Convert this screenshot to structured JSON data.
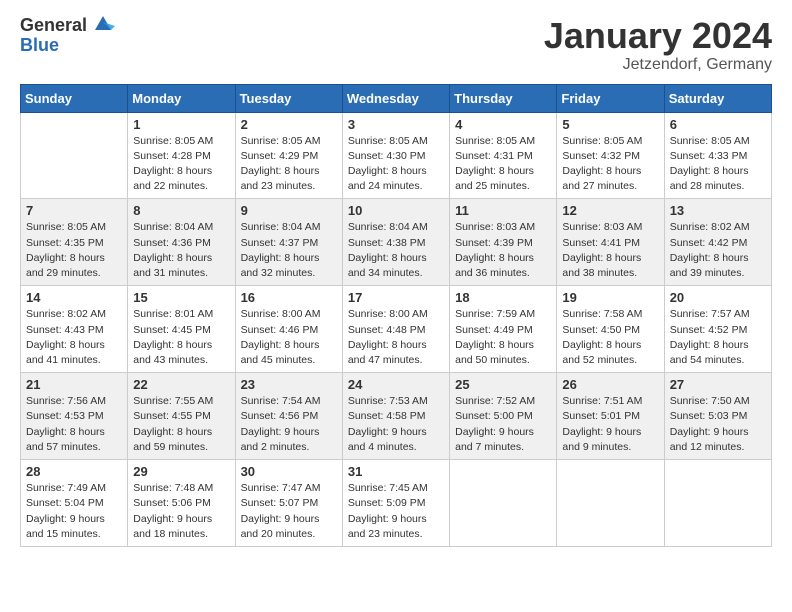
{
  "header": {
    "logo_general": "General",
    "logo_blue": "Blue",
    "month_title": "January 2024",
    "location": "Jetzendorf, Germany"
  },
  "days_of_week": [
    "Sunday",
    "Monday",
    "Tuesday",
    "Wednesday",
    "Thursday",
    "Friday",
    "Saturday"
  ],
  "weeks": [
    [
      {
        "day": "",
        "sunrise": "",
        "sunset": "",
        "daylight": ""
      },
      {
        "day": "1",
        "sunrise": "Sunrise: 8:05 AM",
        "sunset": "Sunset: 4:28 PM",
        "daylight": "Daylight: 8 hours and 22 minutes."
      },
      {
        "day": "2",
        "sunrise": "Sunrise: 8:05 AM",
        "sunset": "Sunset: 4:29 PM",
        "daylight": "Daylight: 8 hours and 23 minutes."
      },
      {
        "day": "3",
        "sunrise": "Sunrise: 8:05 AM",
        "sunset": "Sunset: 4:30 PM",
        "daylight": "Daylight: 8 hours and 24 minutes."
      },
      {
        "day": "4",
        "sunrise": "Sunrise: 8:05 AM",
        "sunset": "Sunset: 4:31 PM",
        "daylight": "Daylight: 8 hours and 25 minutes."
      },
      {
        "day": "5",
        "sunrise": "Sunrise: 8:05 AM",
        "sunset": "Sunset: 4:32 PM",
        "daylight": "Daylight: 8 hours and 27 minutes."
      },
      {
        "day": "6",
        "sunrise": "Sunrise: 8:05 AM",
        "sunset": "Sunset: 4:33 PM",
        "daylight": "Daylight: 8 hours and 28 minutes."
      }
    ],
    [
      {
        "day": "7",
        "sunrise": "Sunrise: 8:05 AM",
        "sunset": "Sunset: 4:35 PM",
        "daylight": "Daylight: 8 hours and 29 minutes."
      },
      {
        "day": "8",
        "sunrise": "Sunrise: 8:04 AM",
        "sunset": "Sunset: 4:36 PM",
        "daylight": "Daylight: 8 hours and 31 minutes."
      },
      {
        "day": "9",
        "sunrise": "Sunrise: 8:04 AM",
        "sunset": "Sunset: 4:37 PM",
        "daylight": "Daylight: 8 hours and 32 minutes."
      },
      {
        "day": "10",
        "sunrise": "Sunrise: 8:04 AM",
        "sunset": "Sunset: 4:38 PM",
        "daylight": "Daylight: 8 hours and 34 minutes."
      },
      {
        "day": "11",
        "sunrise": "Sunrise: 8:03 AM",
        "sunset": "Sunset: 4:39 PM",
        "daylight": "Daylight: 8 hours and 36 minutes."
      },
      {
        "day": "12",
        "sunrise": "Sunrise: 8:03 AM",
        "sunset": "Sunset: 4:41 PM",
        "daylight": "Daylight: 8 hours and 38 minutes."
      },
      {
        "day": "13",
        "sunrise": "Sunrise: 8:02 AM",
        "sunset": "Sunset: 4:42 PM",
        "daylight": "Daylight: 8 hours and 39 minutes."
      }
    ],
    [
      {
        "day": "14",
        "sunrise": "Sunrise: 8:02 AM",
        "sunset": "Sunset: 4:43 PM",
        "daylight": "Daylight: 8 hours and 41 minutes."
      },
      {
        "day": "15",
        "sunrise": "Sunrise: 8:01 AM",
        "sunset": "Sunset: 4:45 PM",
        "daylight": "Daylight: 8 hours and 43 minutes."
      },
      {
        "day": "16",
        "sunrise": "Sunrise: 8:00 AM",
        "sunset": "Sunset: 4:46 PM",
        "daylight": "Daylight: 8 hours and 45 minutes."
      },
      {
        "day": "17",
        "sunrise": "Sunrise: 8:00 AM",
        "sunset": "Sunset: 4:48 PM",
        "daylight": "Daylight: 8 hours and 47 minutes."
      },
      {
        "day": "18",
        "sunrise": "Sunrise: 7:59 AM",
        "sunset": "Sunset: 4:49 PM",
        "daylight": "Daylight: 8 hours and 50 minutes."
      },
      {
        "day": "19",
        "sunrise": "Sunrise: 7:58 AM",
        "sunset": "Sunset: 4:50 PM",
        "daylight": "Daylight: 8 hours and 52 minutes."
      },
      {
        "day": "20",
        "sunrise": "Sunrise: 7:57 AM",
        "sunset": "Sunset: 4:52 PM",
        "daylight": "Daylight: 8 hours and 54 minutes."
      }
    ],
    [
      {
        "day": "21",
        "sunrise": "Sunrise: 7:56 AM",
        "sunset": "Sunset: 4:53 PM",
        "daylight": "Daylight: 8 hours and 57 minutes."
      },
      {
        "day": "22",
        "sunrise": "Sunrise: 7:55 AM",
        "sunset": "Sunset: 4:55 PM",
        "daylight": "Daylight: 8 hours and 59 minutes."
      },
      {
        "day": "23",
        "sunrise": "Sunrise: 7:54 AM",
        "sunset": "Sunset: 4:56 PM",
        "daylight": "Daylight: 9 hours and 2 minutes."
      },
      {
        "day": "24",
        "sunrise": "Sunrise: 7:53 AM",
        "sunset": "Sunset: 4:58 PM",
        "daylight": "Daylight: 9 hours and 4 minutes."
      },
      {
        "day": "25",
        "sunrise": "Sunrise: 7:52 AM",
        "sunset": "Sunset: 5:00 PM",
        "daylight": "Daylight: 9 hours and 7 minutes."
      },
      {
        "day": "26",
        "sunrise": "Sunrise: 7:51 AM",
        "sunset": "Sunset: 5:01 PM",
        "daylight": "Daylight: 9 hours and 9 minutes."
      },
      {
        "day": "27",
        "sunrise": "Sunrise: 7:50 AM",
        "sunset": "Sunset: 5:03 PM",
        "daylight": "Daylight: 9 hours and 12 minutes."
      }
    ],
    [
      {
        "day": "28",
        "sunrise": "Sunrise: 7:49 AM",
        "sunset": "Sunset: 5:04 PM",
        "daylight": "Daylight: 9 hours and 15 minutes."
      },
      {
        "day": "29",
        "sunrise": "Sunrise: 7:48 AM",
        "sunset": "Sunset: 5:06 PM",
        "daylight": "Daylight: 9 hours and 18 minutes."
      },
      {
        "day": "30",
        "sunrise": "Sunrise: 7:47 AM",
        "sunset": "Sunset: 5:07 PM",
        "daylight": "Daylight: 9 hours and 20 minutes."
      },
      {
        "day": "31",
        "sunrise": "Sunrise: 7:45 AM",
        "sunset": "Sunset: 5:09 PM",
        "daylight": "Daylight: 9 hours and 23 minutes."
      },
      {
        "day": "",
        "sunrise": "",
        "sunset": "",
        "daylight": ""
      },
      {
        "day": "",
        "sunrise": "",
        "sunset": "",
        "daylight": ""
      },
      {
        "day": "",
        "sunrise": "",
        "sunset": "",
        "daylight": ""
      }
    ]
  ]
}
